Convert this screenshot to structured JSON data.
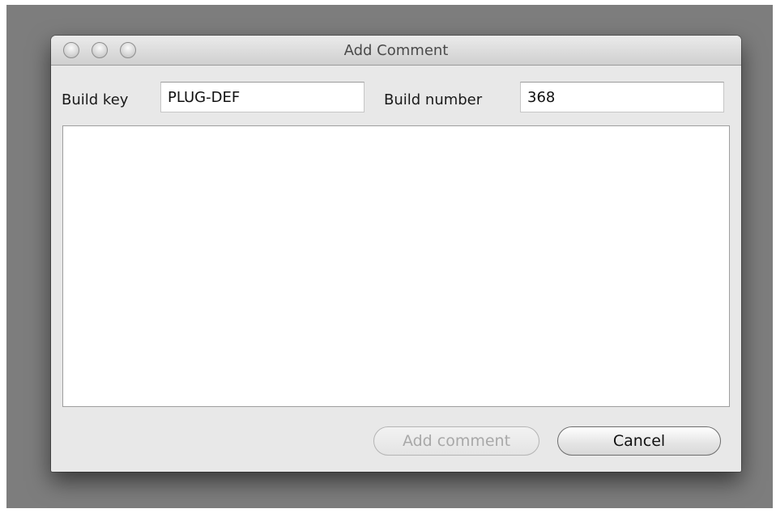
{
  "window": {
    "title": "Add Comment"
  },
  "form": {
    "build_key_label": "Build key",
    "build_key_value": "PLUG-DEF",
    "build_number_label": "Build number",
    "build_number_value": "368",
    "comment_value": ""
  },
  "buttons": {
    "add_comment_label": "Add comment",
    "add_comment_enabled": false,
    "cancel_label": "Cancel"
  },
  "colors": {
    "backdrop": "#7d7d7d",
    "window_bg": "#e8e8e8",
    "disabled_text": "#a8a8a8"
  }
}
